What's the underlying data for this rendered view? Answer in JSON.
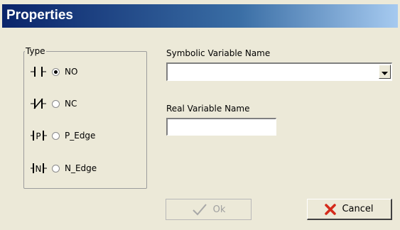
{
  "window": {
    "title": "Properties"
  },
  "type_group": {
    "label": "Type",
    "options": [
      {
        "label": "NO",
        "checked": true,
        "symbol_icon": "no-contact-icon"
      },
      {
        "label": "NC",
        "checked": false,
        "symbol_icon": "nc-contact-icon"
      },
      {
        "label": "P_Edge",
        "checked": false,
        "symbol_icon": "p-edge-contact-icon"
      },
      {
        "label": "N_Edge",
        "checked": false,
        "symbol_icon": "n-edge-contact-icon"
      }
    ]
  },
  "symbolic_variable": {
    "label": "Symbolic Variable Name",
    "value": ""
  },
  "real_variable": {
    "label": "Real Variable Name",
    "value": ""
  },
  "buttons": {
    "ok_label": "Ok",
    "ok_enabled": false,
    "ok_icon": "checkmark-icon",
    "cancel_label": "Cancel",
    "cancel_icon": "red-x-icon"
  },
  "colors": {
    "title_bar_start": "#0a246a",
    "title_bar_end": "#a6caf0",
    "dialog_bg": "#ece9d8",
    "cancel_icon": "#d42a1a"
  }
}
